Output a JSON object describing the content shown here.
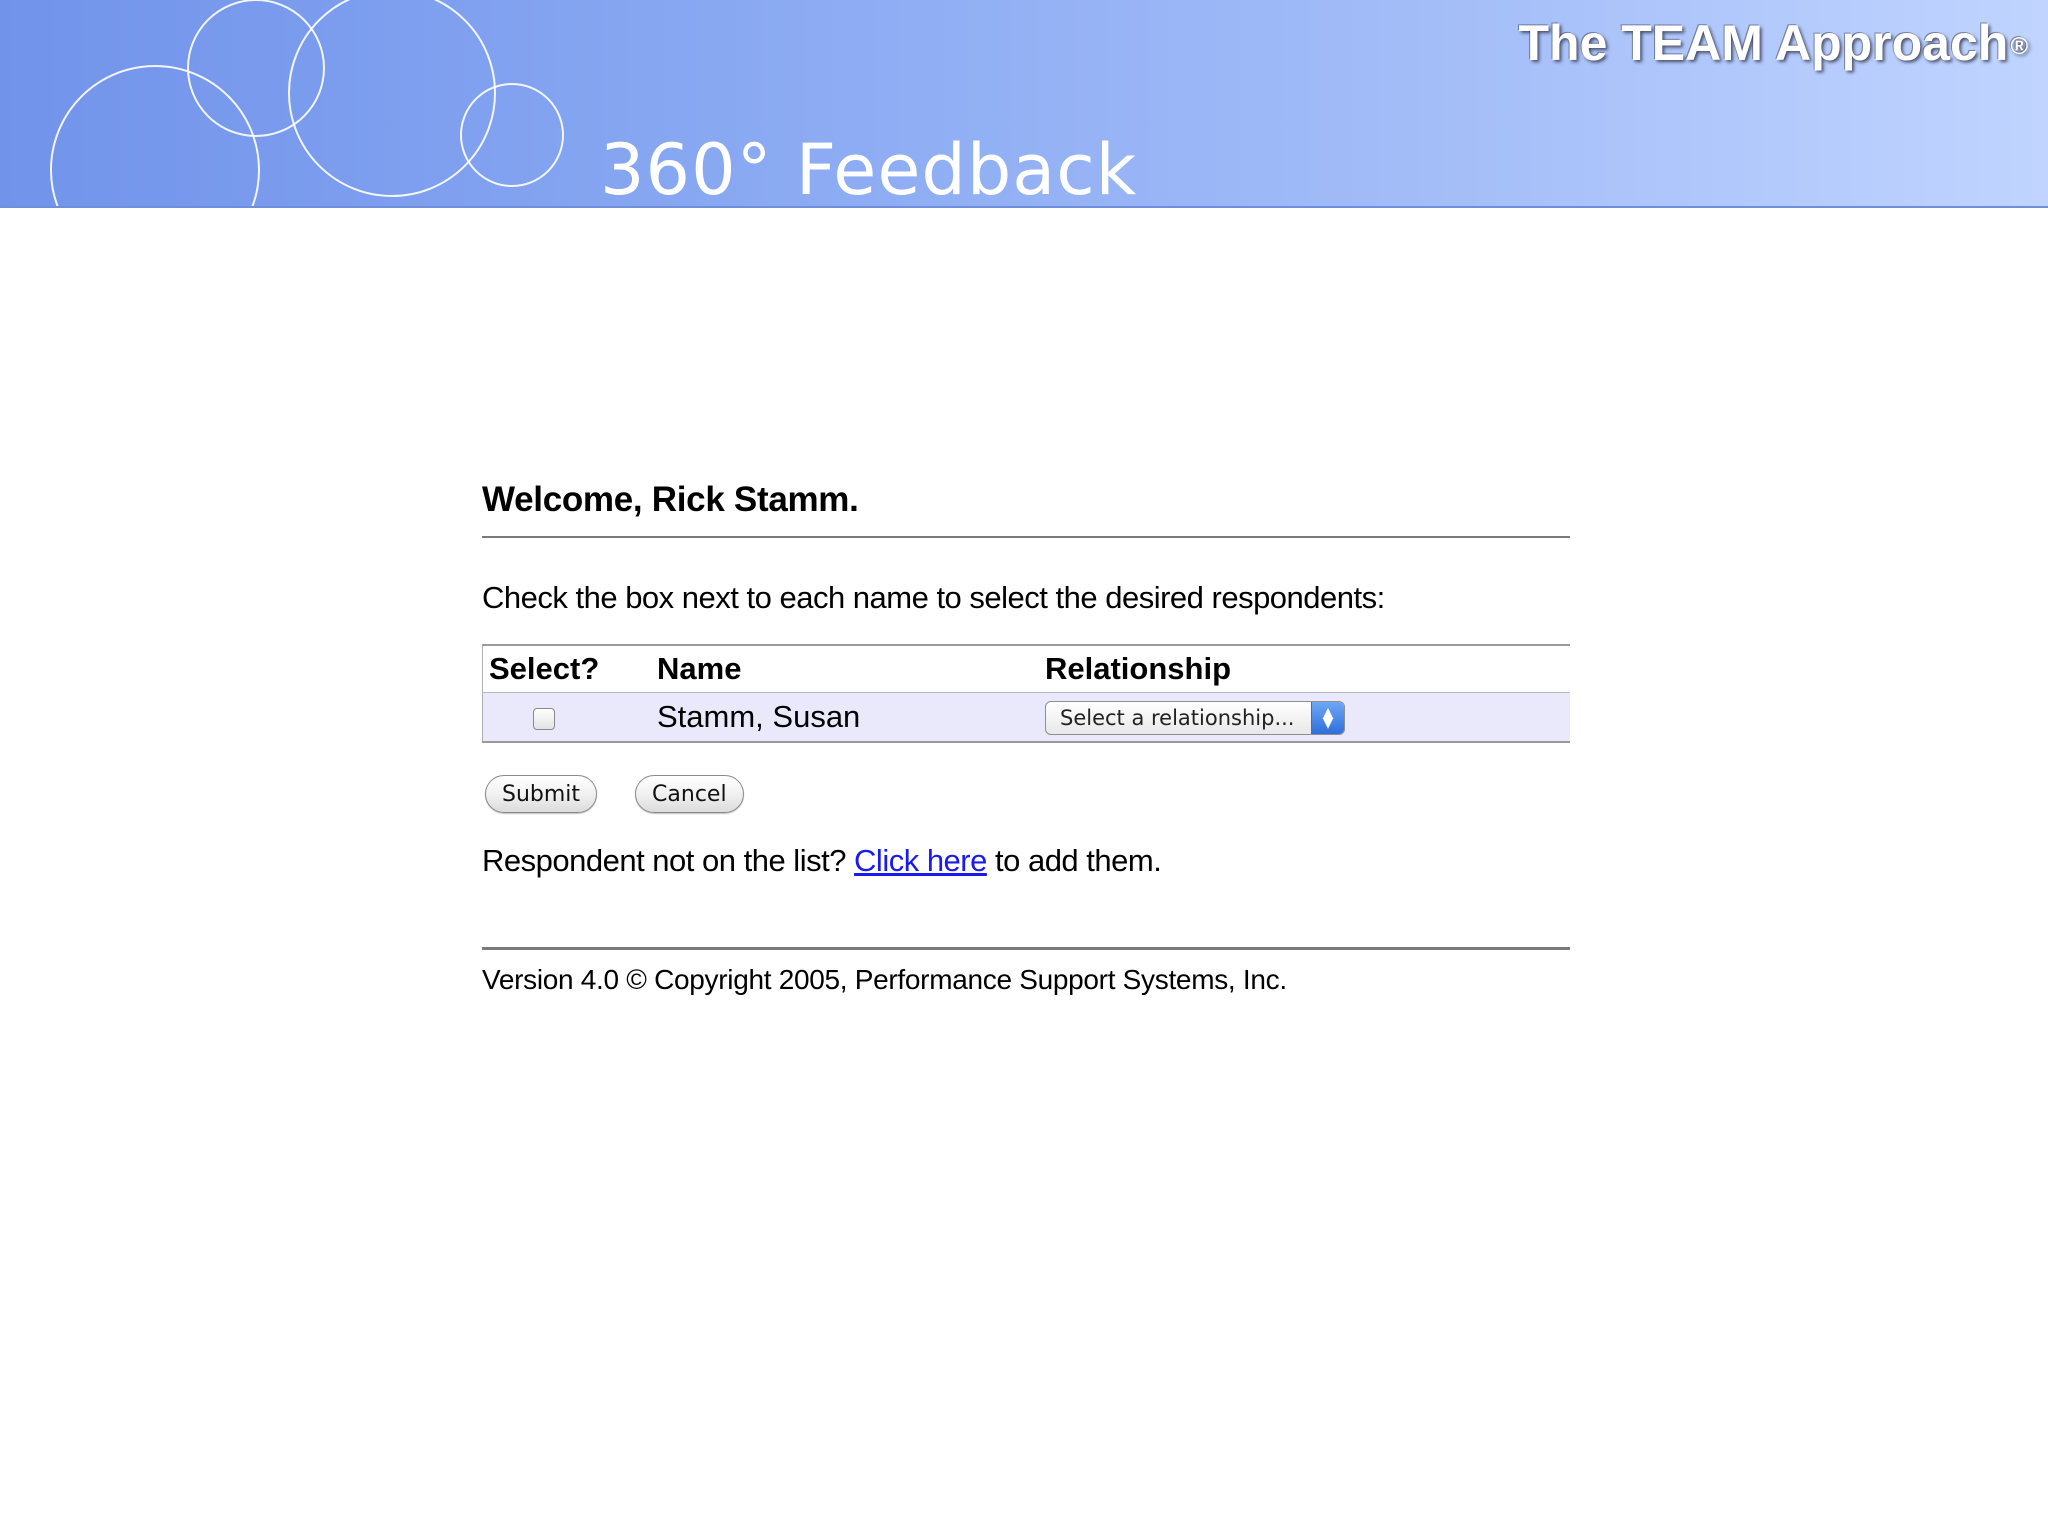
{
  "header": {
    "brand": "The TEAM Approach",
    "brand_mark": "®",
    "product_title": "360° Feedback"
  },
  "main": {
    "welcome": "Welcome, Rick Stamm.",
    "instructions": "Check the box next to each name to select the desired respondents:",
    "table": {
      "columns": [
        "Select?",
        "Name",
        "Relationship"
      ],
      "rows": [
        {
          "checked": false,
          "name": "Stamm, Susan",
          "relationship": "Select a relationship..."
        }
      ]
    },
    "buttons": {
      "submit": "Submit",
      "cancel": "Cancel"
    },
    "add_respondent": {
      "prefix": "Respondent not on the list? ",
      "link": "Click here",
      "suffix": " to add them."
    }
  },
  "footer": {
    "text": "Version 4.0 © Copyright 2005, Performance Support Systems, Inc."
  },
  "colors": {
    "banner_start": "#7193ea",
    "banner_end": "#c0d4ff",
    "row_highlight": "#e9e9fb",
    "link": "#1a1aee"
  }
}
